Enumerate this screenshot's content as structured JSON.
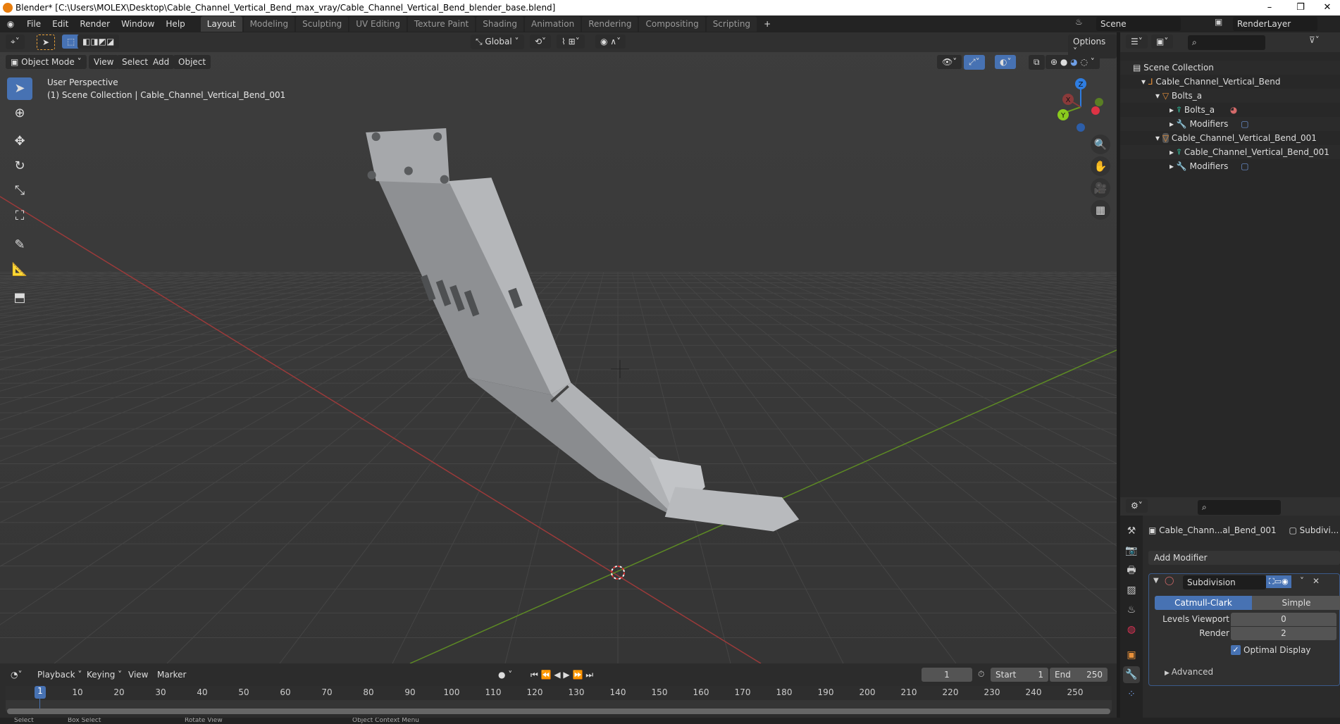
{
  "window": {
    "title": "Blender* [C:\\Users\\MOLEX\\Desktop\\Cable_Channel_Vertical_Bend_max_vray/Cable_Channel_Vertical_Bend_blender_base.blend]",
    "minimize": "–",
    "maximize": "❐",
    "close": "✕"
  },
  "menu": [
    "File",
    "Edit",
    "Render",
    "Window",
    "Help"
  ],
  "workspaces": [
    {
      "label": "Layout",
      "active": true
    },
    {
      "label": "Modeling"
    },
    {
      "label": "Sculpting"
    },
    {
      "label": "UV Editing"
    },
    {
      "label": "Texture Paint"
    },
    {
      "label": "Shading"
    },
    {
      "label": "Animation"
    },
    {
      "label": "Rendering"
    },
    {
      "label": "Compositing"
    },
    {
      "label": "Scripting"
    }
  ],
  "add_workspace": "+",
  "scene": {
    "name": "Scene",
    "view_layer": "RenderLayer"
  },
  "tool_header": {
    "orientation": "Global",
    "options": "Options"
  },
  "viewport_header": {
    "mode": "Object Mode",
    "menus": [
      "View",
      "Select",
      "Add",
      "Object"
    ]
  },
  "viewport": {
    "perspective": "User Perspective",
    "context": "(1) Scene Collection | Cable_Channel_Vertical_Bend_001",
    "gizmo": {
      "x": "X",
      "y": "Y",
      "z": "Z"
    }
  },
  "toolbar": [
    "select-box",
    "cursor",
    "move",
    "rotate",
    "scale",
    "transform",
    "annotate",
    "measure",
    "add-cube"
  ],
  "outliner": {
    "root": "Scene Collection",
    "items": [
      {
        "label": "Cable_Channel_Vertical_Bend",
        "level": 1,
        "icon": "empty-icon",
        "expanded": true
      },
      {
        "label": "Bolts_a",
        "level": 2,
        "icon": "mesh-object-icon",
        "expanded": true
      },
      {
        "label": "Bolts_a",
        "level": 3,
        "icon": "mesh-data-icon"
      },
      {
        "label": "Modifiers",
        "level": 3,
        "icon": "wrench-icon"
      },
      {
        "label": "Cable_Channel_Vertical_Bend_001",
        "level": 2,
        "icon": "mesh-object-icon",
        "expanded": true,
        "selected": true
      },
      {
        "label": "Cable_Channel_Vertical_Bend_001",
        "level": 3,
        "icon": "mesh-data-icon"
      },
      {
        "label": "Modifiers",
        "level": 3,
        "icon": "wrench-icon"
      }
    ]
  },
  "properties": {
    "breadcrumb_object": "Cable_Chann...al_Bend_001",
    "breadcrumb_modifier": "Subdivi...",
    "add_modifier": "Add Modifier",
    "modifier": {
      "name": "Subdivision",
      "type_options": [
        "Catmull-Clark",
        "Simple"
      ],
      "selected_type": "Catmull-Clark",
      "levels_viewport_label": "Levels Viewport",
      "levels_viewport": "0",
      "render_label": "Render",
      "render": "2",
      "optimal_display_label": "Optimal Display",
      "optimal_display": true,
      "advanced": "Advanced"
    }
  },
  "timeline": {
    "menus": [
      "Playback",
      "Keying",
      "View",
      "Marker"
    ],
    "current_frame": "1",
    "start_label": "Start",
    "start": "1",
    "end_label": "End",
    "end": "250",
    "ticks": [
      "10",
      "20",
      "30",
      "40",
      "50",
      "60",
      "70",
      "80",
      "90",
      "100",
      "110",
      "120",
      "130",
      "140",
      "150",
      "160",
      "170",
      "180",
      "190",
      "200",
      "210",
      "220",
      "230",
      "240",
      "250"
    ]
  },
  "status": [
    "Select",
    "Box Select",
    "Rotate View",
    "Object Context Menu"
  ],
  "colors": {
    "accent": "#4772b3",
    "x_axis": "#c0392b",
    "y_axis": "#6a9a1f",
    "z_axis": "#2e7de1"
  }
}
